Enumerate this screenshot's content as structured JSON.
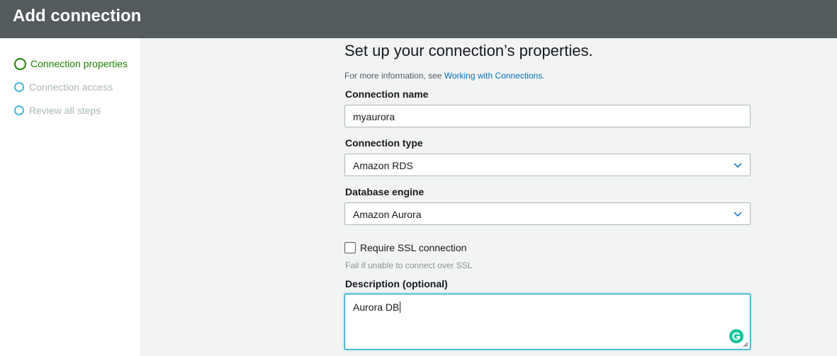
{
  "header": {
    "title": "Add connection"
  },
  "sidebar": {
    "steps": [
      {
        "label": "Connection properties",
        "state": "active"
      },
      {
        "label": "Connection access",
        "state": "inactive"
      },
      {
        "label": "Review all steps",
        "state": "inactive"
      }
    ]
  },
  "main": {
    "title": "Set up your connection’s properties.",
    "info_prefix": "For more information, see ",
    "info_link": "Working with Connections",
    "info_suffix": ".",
    "connection_name": {
      "label": "Connection name",
      "value": "myaurora"
    },
    "connection_type": {
      "label": "Connection type",
      "value": "Amazon RDS"
    },
    "database_engine": {
      "label": "Database engine",
      "value": "Amazon Aurora"
    },
    "ssl": {
      "label": "Require SSL connection",
      "checked": false,
      "hint": "Fail if unable to connect over SSL"
    },
    "description": {
      "label": "Description (optional)",
      "value": "Aurora DB"
    }
  },
  "icons": {
    "select_chevron": "chevron-down-icon",
    "grammarly": "grammarly-icon",
    "resize": "resize-grip-icon"
  },
  "colors": {
    "header_bg": "#545b5c",
    "active_step": "#1d8102",
    "inactive_step_circle": "#44b9d6",
    "link": "#0073bb",
    "focus_border": "#00a1c9",
    "grammarly": "#15c39a"
  }
}
